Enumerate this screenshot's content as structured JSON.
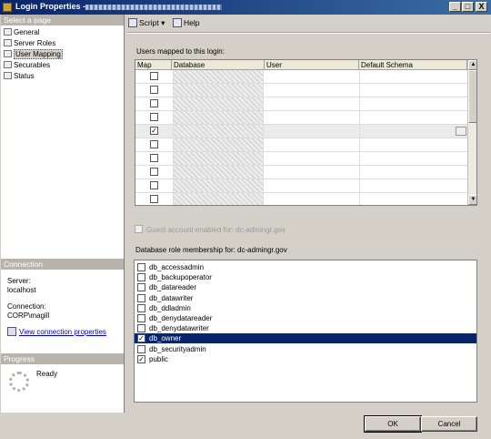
{
  "window": {
    "title": "Login Properties -",
    "buttons": [
      "_",
      "□",
      "X"
    ]
  },
  "left": {
    "select_page_header": "Select a page",
    "pages": [
      {
        "label": "General",
        "icon": "page-icon"
      },
      {
        "label": "Server Roles",
        "icon": "page-icon"
      },
      {
        "label": "User Mapping",
        "icon": "page-icon",
        "selected": true
      },
      {
        "label": "Securables",
        "icon": "page-icon"
      },
      {
        "label": "Status",
        "icon": "page-icon"
      }
    ],
    "connection_header": "Connection",
    "server_label": "Server:",
    "server_value": "localhost",
    "connection_label": "Connection:",
    "connection_value": "CORP\\magill",
    "view_link": "View connection properties",
    "progress_header": "Progress",
    "progress_status": "Ready"
  },
  "toolbar": {
    "script_label": "Script",
    "help_label": "Help"
  },
  "mapping": {
    "label": "Users mapped to this login:",
    "columns": [
      "Map",
      "Database",
      "User",
      "Default Schema"
    ],
    "rows": [
      {
        "checked": false
      },
      {
        "checked": false
      },
      {
        "checked": false
      },
      {
        "checked": false
      },
      {
        "checked": true,
        "selected": true
      },
      {
        "checked": false
      },
      {
        "checked": false
      },
      {
        "checked": false
      },
      {
        "checked": false
      },
      {
        "checked": false
      }
    ]
  },
  "guest": {
    "label": "Guest account enabled for: dc-admingr.gov",
    "checked": false
  },
  "roles": {
    "label": "Database role membership for: dc-admingr.gov",
    "items": [
      {
        "name": "db_accessadmin",
        "checked": false
      },
      {
        "name": "db_backupoperator",
        "checked": false
      },
      {
        "name": "db_datareader",
        "checked": false
      },
      {
        "name": "db_datawriter",
        "checked": false
      },
      {
        "name": "db_ddladmin",
        "checked": false
      },
      {
        "name": "db_denydatareader",
        "checked": false
      },
      {
        "name": "db_denydatawriter",
        "checked": false
      },
      {
        "name": "db_owner",
        "checked": true,
        "selected": true
      },
      {
        "name": "db_securityadmin",
        "checked": false
      },
      {
        "name": "public",
        "checked": true
      }
    ]
  },
  "footer": {
    "ok_label": "OK",
    "cancel_label": "Cancel"
  },
  "colors": {
    "title_bar": "#0a246a",
    "selection": "#0a246a",
    "window_bg": "#d4d0c8"
  }
}
